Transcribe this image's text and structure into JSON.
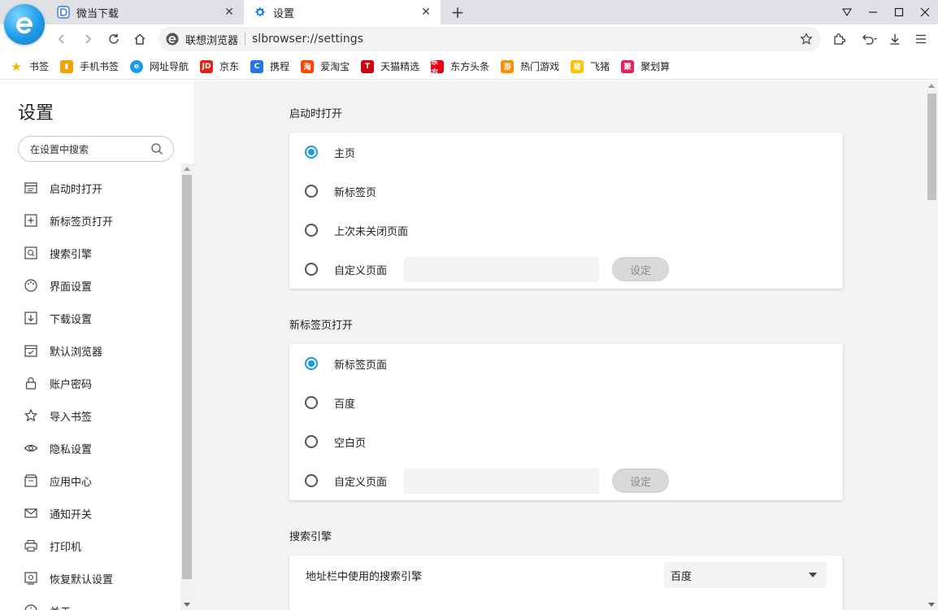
{
  "tabs": [
    {
      "title": "微当下载",
      "icon": "d-letter-icon",
      "active": false
    },
    {
      "title": "设置",
      "icon": "gear-icon",
      "active": true
    }
  ],
  "address_bar": {
    "site_name": "联想浏览器",
    "url": "slbrowser://settings"
  },
  "bookmarks": [
    {
      "label": "书签",
      "icon": "star-icon",
      "color": "#f5b400",
      "glyph": "★"
    },
    {
      "label": "手机书签",
      "icon": "phone-bookmark-icon",
      "color": "#f5a000",
      "glyph": "▮"
    },
    {
      "label": "网址导航",
      "icon": "browser-logo-icon",
      "color": "#1e9be8",
      "glyph": "e"
    },
    {
      "label": "京东",
      "icon": "jd-icon",
      "color": "#e1251b",
      "glyph": "JD"
    },
    {
      "label": "携程",
      "icon": "ctrip-icon",
      "color": "#2577e3",
      "glyph": "C"
    },
    {
      "label": "爱淘宝",
      "icon": "taobao-icon",
      "color": "#ff4400",
      "glyph": "淘"
    },
    {
      "label": "天猫精选",
      "icon": "tmall-icon",
      "color": "#d4000f",
      "glyph": "T"
    },
    {
      "label": "东方头条",
      "icon": "dftt-icon",
      "color": "#e60012",
      "glyph": "东方"
    },
    {
      "label": "热门游戏",
      "icon": "game-icon",
      "color": "#ff8a00",
      "glyph": "游"
    },
    {
      "label": "飞猪",
      "icon": "fliggy-icon",
      "color": "#ffc300",
      "glyph": "猪"
    },
    {
      "label": "聚划算",
      "icon": "juhuasuan-icon",
      "color": "#e2245b",
      "glyph": "聚"
    }
  ],
  "sidebar": {
    "title": "设置",
    "search_placeholder": "在设置中搜索",
    "items": [
      {
        "label": "启动时打开",
        "icon": "startup-icon"
      },
      {
        "label": "新标签页打开",
        "icon": "new-tab-icon"
      },
      {
        "label": "搜索引擎",
        "icon": "search-engine-icon"
      },
      {
        "label": "界面设置",
        "icon": "palette-icon"
      },
      {
        "label": "下载设置",
        "icon": "download-icon"
      },
      {
        "label": "默认浏览器",
        "icon": "default-browser-icon"
      },
      {
        "label": "账户密码",
        "icon": "lock-icon"
      },
      {
        "label": "导入书签",
        "icon": "star-outline-icon"
      },
      {
        "label": "隐私设置",
        "icon": "eye-icon"
      },
      {
        "label": "应用中心",
        "icon": "app-center-icon"
      },
      {
        "label": "通知开关",
        "icon": "mail-icon"
      },
      {
        "label": "打印机",
        "icon": "printer-icon"
      },
      {
        "label": "恢复默认设置",
        "icon": "restore-icon"
      },
      {
        "label": "关于",
        "icon": "info-icon"
      }
    ]
  },
  "main": {
    "startup": {
      "title": "启动时打开",
      "options": [
        "主页",
        "新标签页",
        "上次未关闭页面",
        "自定义页面"
      ],
      "selected": 0,
      "set_button": "设定"
    },
    "newtab": {
      "title": "新标签页打开",
      "options": [
        "新标签页面",
        "百度",
        "空白页",
        "自定义页面"
      ],
      "selected": 0,
      "set_button": "设定"
    },
    "search": {
      "title": "搜索引擎",
      "address_bar_engine_label": "地址栏中使用的搜索引擎",
      "address_bar_engine_value": "百度"
    }
  },
  "colors": {
    "accent": "#1a9be0",
    "content_bg": "#f1f3f4",
    "tabbar_bg": "#dfe1e5"
  }
}
